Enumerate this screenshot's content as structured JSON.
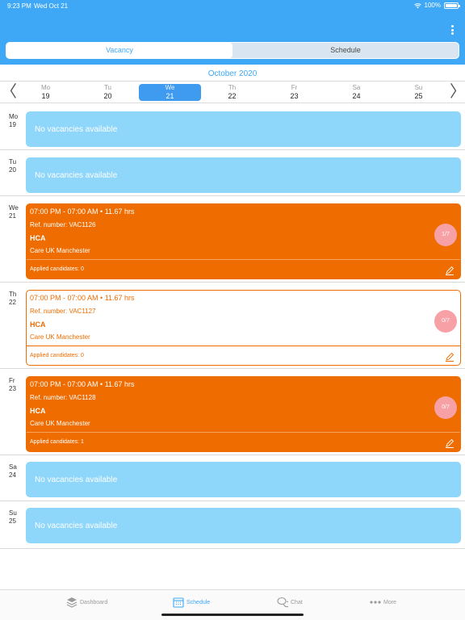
{
  "status": {
    "time": "9:23 PM",
    "date": "Wed Oct 21",
    "battery": "100%"
  },
  "tabs": {
    "vacancy": "Vacancy",
    "schedule": "Schedule"
  },
  "month": "October 2020",
  "week": [
    {
      "name": "Mo",
      "num": "19"
    },
    {
      "name": "Tu",
      "num": "20"
    },
    {
      "name": "We",
      "num": "21"
    },
    {
      "name": "Th",
      "num": "22"
    },
    {
      "name": "Fr",
      "num": "23"
    },
    {
      "name": "Sa",
      "num": "24"
    },
    {
      "name": "Su",
      "num": "25"
    }
  ],
  "arrows": {
    "prev": "〈",
    "next": "〉"
  },
  "days": [
    {
      "name": "Mo",
      "num": "19",
      "empty_text": "No vacancies available"
    },
    {
      "name": "Tu",
      "num": "20",
      "empty_text": "No vacancies available"
    },
    {
      "name": "We",
      "num": "21",
      "shift": {
        "time": "07:00 PM - 07:00 AM  •  11.67 hrs",
        "ref": "Ref. number: VAC1126",
        "role": "HCA",
        "org": "Care UK Manchester",
        "applied": "Applied candidates: 0",
        "badge": "1/7"
      }
    },
    {
      "name": "Th",
      "num": "22",
      "shift": {
        "time": "07:00 PM - 07:00 AM  •  11.67 hrs",
        "ref": "Ref. number: VAC1127",
        "role": "HCA",
        "org": "Care UK Manchester",
        "applied": "Applied candidates: 0",
        "badge": "0/7"
      }
    },
    {
      "name": "Fr",
      "num": "23",
      "shift": {
        "time": "07:00 PM - 07:00 AM  •  11.67 hrs",
        "ref": "Ref. number: VAC1128",
        "role": "HCA",
        "org": "Care UK Manchester",
        "applied": "Applied candidates: 1",
        "badge": "0/7"
      }
    },
    {
      "name": "Sa",
      "num": "24",
      "empty_text": "No vacancies available"
    },
    {
      "name": "Su",
      "num": "25",
      "empty_text": "No vacancies available"
    }
  ],
  "bottom_tabs": {
    "dashboard": "Dashboard",
    "schedule": "Schedule",
    "chat": "Chat",
    "more": "More"
  },
  "colors": {
    "header": "#3ea8f7",
    "empty_card": "#8fd6fb",
    "shift_orange": "#ef6c00",
    "badge": "#f7a0a6"
  }
}
